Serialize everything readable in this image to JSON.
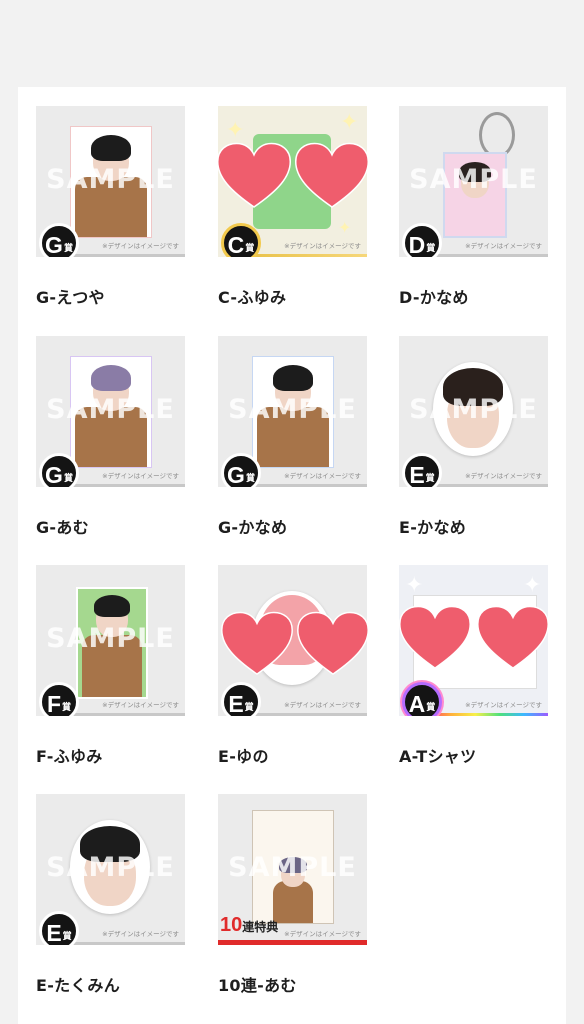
{
  "items": [
    {
      "label": "G-えつや",
      "badge": "G",
      "suffix": "賞",
      "sample": "SAMPLE",
      "disclaimer": "※デザインはイメージです"
    },
    {
      "label": "C-ふゆみ",
      "badge": "C",
      "suffix": "賞",
      "sample": "",
      "disclaimer": "※デザインはイメージです"
    },
    {
      "label": "D-かなめ",
      "badge": "D",
      "suffix": "賞",
      "sample": "SAMPLE",
      "disclaimer": "※デザインはイメージです"
    },
    {
      "label": "G-あむ",
      "badge": "G",
      "suffix": "賞",
      "sample": "SAMPLE",
      "disclaimer": "※デザインはイメージです"
    },
    {
      "label": "G-かなめ",
      "badge": "G",
      "suffix": "賞",
      "sample": "SAMPLE",
      "disclaimer": "※デザインはイメージです"
    },
    {
      "label": "E-かなめ",
      "badge": "E",
      "suffix": "賞",
      "sample": "SAMPLE",
      "disclaimer": "※デザインはイメージです"
    },
    {
      "label": "F-ふゆみ",
      "badge": "F",
      "suffix": "賞",
      "sample": "SAMPLE",
      "disclaimer": "※デザインはイメージです"
    },
    {
      "label": "E-ゆの",
      "badge": "E",
      "suffix": "賞",
      "sample": "",
      "disclaimer": "※デザインはイメージです"
    },
    {
      "label": "A-Tシャツ",
      "badge": "A",
      "suffix": "賞",
      "sample": "",
      "disclaimer": "※デザインはイメージです"
    },
    {
      "label": "E-たくみん",
      "badge": "E",
      "suffix": "賞",
      "sample": "SAMPLE",
      "disclaimer": "※デザインはイメージです"
    },
    {
      "label": "10連-あむ",
      "badge": "10",
      "suffix": "連特典",
      "sample": "SAMPLE",
      "disclaimer": "※デザインはイメージです"
    }
  ],
  "colors": {
    "page_bg": "#f2f2f2",
    "card_bg": "#ebebeb",
    "badge": "#141414",
    "heart": "#ef5d6d",
    "ten_red": "#e02b2b"
  }
}
